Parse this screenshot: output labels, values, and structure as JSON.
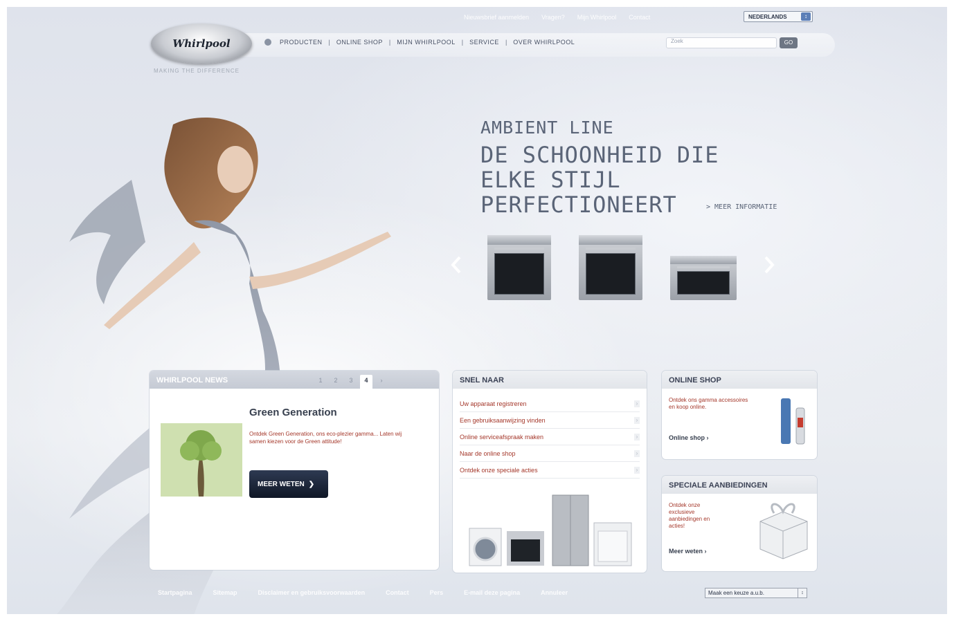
{
  "header": {
    "utility_links": [
      "Nieuwsbrief aanmelden",
      "Vragen?",
      "Mijn Whirlpool",
      "Contact"
    ],
    "language": "NEDERLANDS",
    "logo_text": "Whirlpool",
    "tagline": "MAKING THE DIFFERENCE",
    "nav": [
      "PRODUCTEN",
      "ONLINE SHOP",
      "MIJN WHIRLPOOL",
      "SERVICE",
      "OVER WHIRLPOOL"
    ],
    "search_placeholder": "Zoek",
    "search_button": "GO"
  },
  "hero": {
    "kicker": "AMBIENT LINE",
    "title_line1": "DE SCHOONHEID DIE",
    "title_line2": "ELKE STIJL PERFECTIONEERT",
    "more": "> MEER INFORMATIE"
  },
  "news": {
    "title": "WHIRLPOOL NEWS",
    "pages": [
      "1",
      "2",
      "3",
      "4",
      "›"
    ],
    "active_page": "4",
    "headline": "Green Generation",
    "body": "Ontdek Green Generation, ons eco-plezier gamma... Laten wij samen kiezen voor de Green attitude!",
    "button": "MEER WETEN"
  },
  "snel_naar": {
    "title": "SNEL NAAR",
    "links": [
      "Uw apparaat registreren",
      "Een gebruiksaanwijzing vinden",
      "Online serviceafspraak maken",
      "Naar de online shop",
      "Ontdek onze speciale acties"
    ]
  },
  "online_shop": {
    "title": "ONLINE SHOP",
    "body": "Ontdek ons gamma accessoires en koop online.",
    "link": "Online shop"
  },
  "offers": {
    "title": "SPECIALE AANBIEDINGEN",
    "body": "Ontdek onze exclusieve aanbiedingen en acties!",
    "link": "Meer weten"
  },
  "footer": {
    "links": [
      "Startpagina",
      "Sitemap",
      "Disclaimer en gebruiksvoorwaarden",
      "Contact",
      "Pers",
      "E-mail deze pagina",
      "Annuleer"
    ],
    "country_select": "Maak een keuze a.u.b."
  },
  "colors": {
    "accent_text": "#5a6477",
    "link_red": "#a4372a",
    "button_dark": "#0f1726"
  }
}
